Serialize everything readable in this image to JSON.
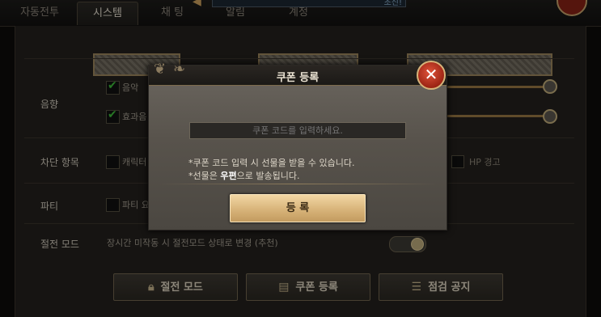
{
  "tabs": [
    {
      "label": "자동전투",
      "active": false
    },
    {
      "label": "시스템",
      "active": true
    },
    {
      "label": "채 팅",
      "active": false
    },
    {
      "label": "알림",
      "active": false
    },
    {
      "label": "계정",
      "active": false
    }
  ],
  "top_banner_text": "초진!",
  "settings": {
    "sound": {
      "label": "음향",
      "music_label": "음악",
      "effect_label": "효과음",
      "music_checked": true,
      "effect_checked": true
    },
    "block": {
      "label": "차단 항목",
      "character_label": "캐릭터",
      "hp_warning_label": "HP 경고"
    },
    "party": {
      "label": "파티",
      "party_option_label": "파티 요"
    },
    "power_save": {
      "label": "절전 모드",
      "description": "장시간 미작동 시 절전모드 상태로 변경 (추천)",
      "enabled": true
    }
  },
  "bottom_buttons": [
    {
      "label": "절전 모드",
      "icon": "lock-icon"
    },
    {
      "label": "쿠폰 등록",
      "icon": "coupon-icon"
    },
    {
      "label": "점검 공지",
      "icon": "notice-icon"
    }
  ],
  "dialog": {
    "title": "쿠폰 등록",
    "input_placeholder": "쿠폰 코드를 입력하세요.",
    "info_line1": "*쿠폰 코드 입력 시 선물을 받을 수 있습니다.",
    "info_line2_prefix": "*선물은 ",
    "info_line2_bold": "우편",
    "info_line2_suffix": "으로 발송됩니다.",
    "register_label": "등 록",
    "close_icon": "close-icon"
  },
  "colors": {
    "accent_gold": "#d8b47a",
    "close_red": "#9c2414",
    "check_green": "#3fbf3a"
  }
}
